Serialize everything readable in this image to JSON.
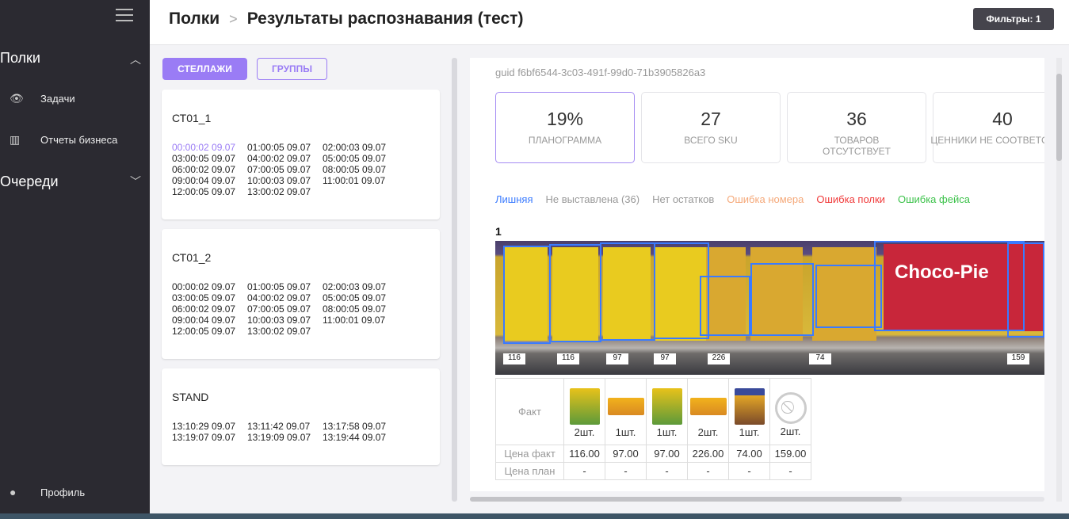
{
  "sidebar": {
    "sections": [
      {
        "label": "Полки",
        "expanded": true
      },
      {
        "label": "Очереди",
        "expanded": false
      }
    ],
    "items": [
      {
        "label": "Задачи",
        "icon": "eye-icon"
      },
      {
        "label": "Отчеты бизнеса",
        "icon": "bar-chart-icon"
      }
    ],
    "profile": "Профиль"
  },
  "header": {
    "breadcrumb": [
      "Полки",
      "Результаты распознавания (тест)"
    ],
    "filters": "Фильтры: 1"
  },
  "tabs": {
    "racks": "СТЕЛЛАЖИ",
    "groups": "ГРУППЫ"
  },
  "racks": [
    {
      "name": "СТ01_1",
      "times": [
        "00:00:02 09.07",
        "01:00:05 09.07",
        "02:00:03 09.07",
        "03:00:05 09.07",
        "04:00:02 09.07",
        "05:00:05 09.07",
        "06:00:02 09.07",
        "07:00:05 09.07",
        "08:00:05 09.07",
        "09:00:04 09.07",
        "10:00:03 09.07",
        "11:00:01 09.07",
        "12:00:05 09.07",
        "13:00:02 09.07"
      ],
      "active": 0
    },
    {
      "name": "СТ01_2",
      "times": [
        "00:00:02 09.07",
        "01:00:05 09.07",
        "02:00:03 09.07",
        "03:00:05 09.07",
        "04:00:02 09.07",
        "05:00:05 09.07",
        "06:00:02 09.07",
        "07:00:05 09.07",
        "08:00:05 09.07",
        "09:00:04 09.07",
        "10:00:03 09.07",
        "11:00:01 09.07",
        "12:00:05 09.07",
        "13:00:02 09.07"
      ],
      "active": -1
    },
    {
      "name": "STAND",
      "times": [
        "13:10:29 09.07",
        "13:11:42 09.07",
        "13:17:58 09.07",
        "13:19:07 09.07",
        "13:19:09 09.07",
        "13:19:44 09.07"
      ],
      "active": -1
    }
  ],
  "main": {
    "guid": "guid f6bf6544-3c03-491f-99d0-71b3905826a3",
    "stats": [
      {
        "value": "19%",
        "label": "ПЛАНОГРАММА"
      },
      {
        "value": "27",
        "label": "ВСЕГО SKU"
      },
      {
        "value": "36",
        "label": "ТОВАРОВ ОТСУТСТВУЕТ"
      },
      {
        "value": "40",
        "label": "ЦЕННИКИ НЕ СООТВЕТСТВУЮТ"
      }
    ],
    "legend": [
      {
        "label": "Лишняя",
        "color": "#3a7bff"
      },
      {
        "label": "Не выставлена (36)",
        "color": "#999999"
      },
      {
        "label": "Нет остатков",
        "color": "#999999"
      },
      {
        "label": "Ошибка номера",
        "color": "#f5a97a"
      },
      {
        "label": "Ошибка полки",
        "color": "#f03a3a"
      },
      {
        "label": "Ошибка фейса",
        "color": "#3cc24a"
      }
    ],
    "shelf": "1",
    "photo_prices": [
      "116",
      "116",
      "97",
      "97",
      "226",
      "74",
      "159"
    ],
    "photo_brand": "Choco-Pie",
    "table": {
      "row_labels": [
        "Факт",
        "Цена факт",
        "Цена план"
      ],
      "columns": [
        {
          "qty": "2шт.",
          "price": "116.00",
          "plan": "-",
          "img": "belvita"
        },
        {
          "qty": "1шт.",
          "price": "97.00",
          "plan": "-",
          "img": "leibniz"
        },
        {
          "qty": "1шт.",
          "price": "97.00",
          "plan": "-",
          "img": "belvita"
        },
        {
          "qty": "2шт.",
          "price": "226.00",
          "plan": "-",
          "img": "leibniz"
        },
        {
          "qty": "1шт.",
          "price": "74.00",
          "plan": "-",
          "img": "leibniz-minis"
        },
        {
          "qty": "2шт.",
          "price": "159.00",
          "plan": "-",
          "img": "no-photo"
        }
      ]
    }
  }
}
